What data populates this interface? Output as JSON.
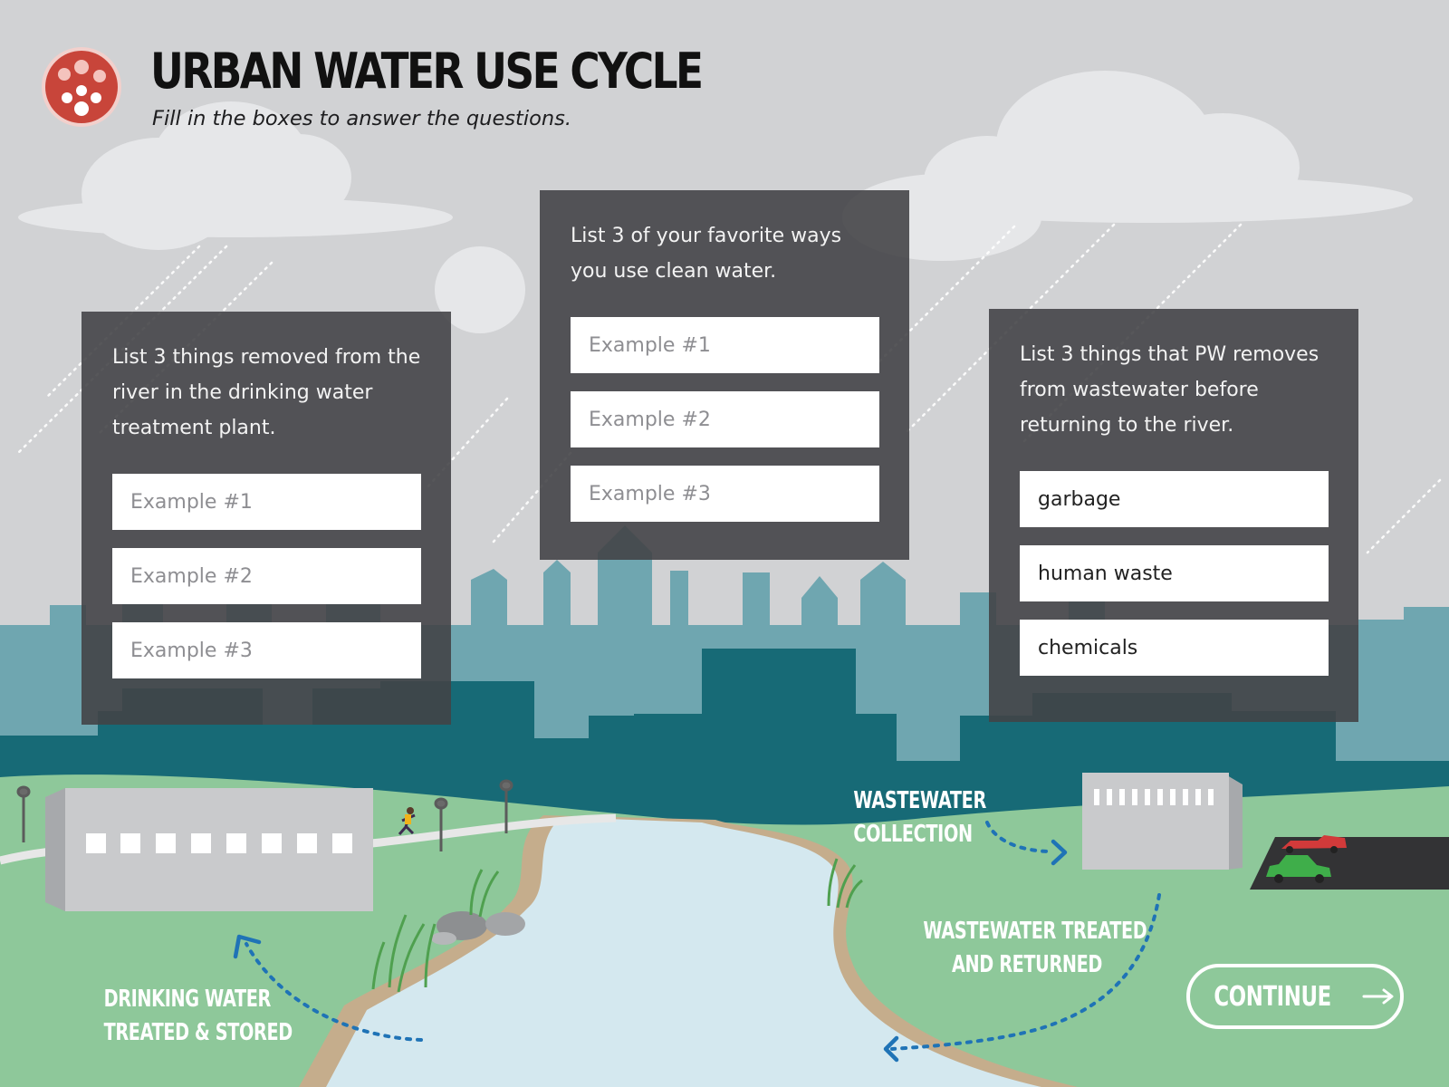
{
  "header": {
    "title": "URBAN WATER USE CYCLE",
    "subtitle": "Fill in the boxes to answer the questions."
  },
  "cards": {
    "left": {
      "prompt": "List 3 things removed from the river in the drinking water treatment plant.",
      "fields": [
        {
          "value": "",
          "placeholder": "Example #1"
        },
        {
          "value": "",
          "placeholder": "Example #2"
        },
        {
          "value": "",
          "placeholder": "Example #3"
        }
      ]
    },
    "middle": {
      "prompt": "List 3 of your favorite ways you use clean water.",
      "fields": [
        {
          "value": "",
          "placeholder": "Example #1"
        },
        {
          "value": "",
          "placeholder": "Example #2"
        },
        {
          "value": "",
          "placeholder": "Example #3"
        }
      ]
    },
    "right": {
      "prompt": "List 3 things that PW removes from wastewater before returning to the river.",
      "fields": [
        {
          "value": "garbage",
          "placeholder": ""
        },
        {
          "value": "human waste",
          "placeholder": ""
        },
        {
          "value": "chemicals",
          "placeholder": ""
        }
      ]
    }
  },
  "scene": {
    "label_drinking_line1": "DRINKING WATER",
    "label_drinking_line2": "TREATED & STORED",
    "label_collection_line1": "WASTEWATER",
    "label_collection_line2": "COLLECTION",
    "label_treated_line1": "WASTEWATER TREATED",
    "label_treated_line2": "AND RETURNED"
  },
  "continue": {
    "label": "CONTINUE"
  },
  "icons": {
    "logo": "water-drops-logo-icon",
    "continue_arrow": "arrow-right-icon",
    "flow_arrows": "dotted-arrow-icon"
  },
  "colors": {
    "sky": "#d1d2d4",
    "card": "#424246",
    "skyline_light": "#6fa6b0",
    "skyline_dark": "#176a76",
    "grass": "#8ec89a",
    "river": "#d4e8ef",
    "logo_red": "#c8453a",
    "arrow_blue": "#1f73b6"
  }
}
